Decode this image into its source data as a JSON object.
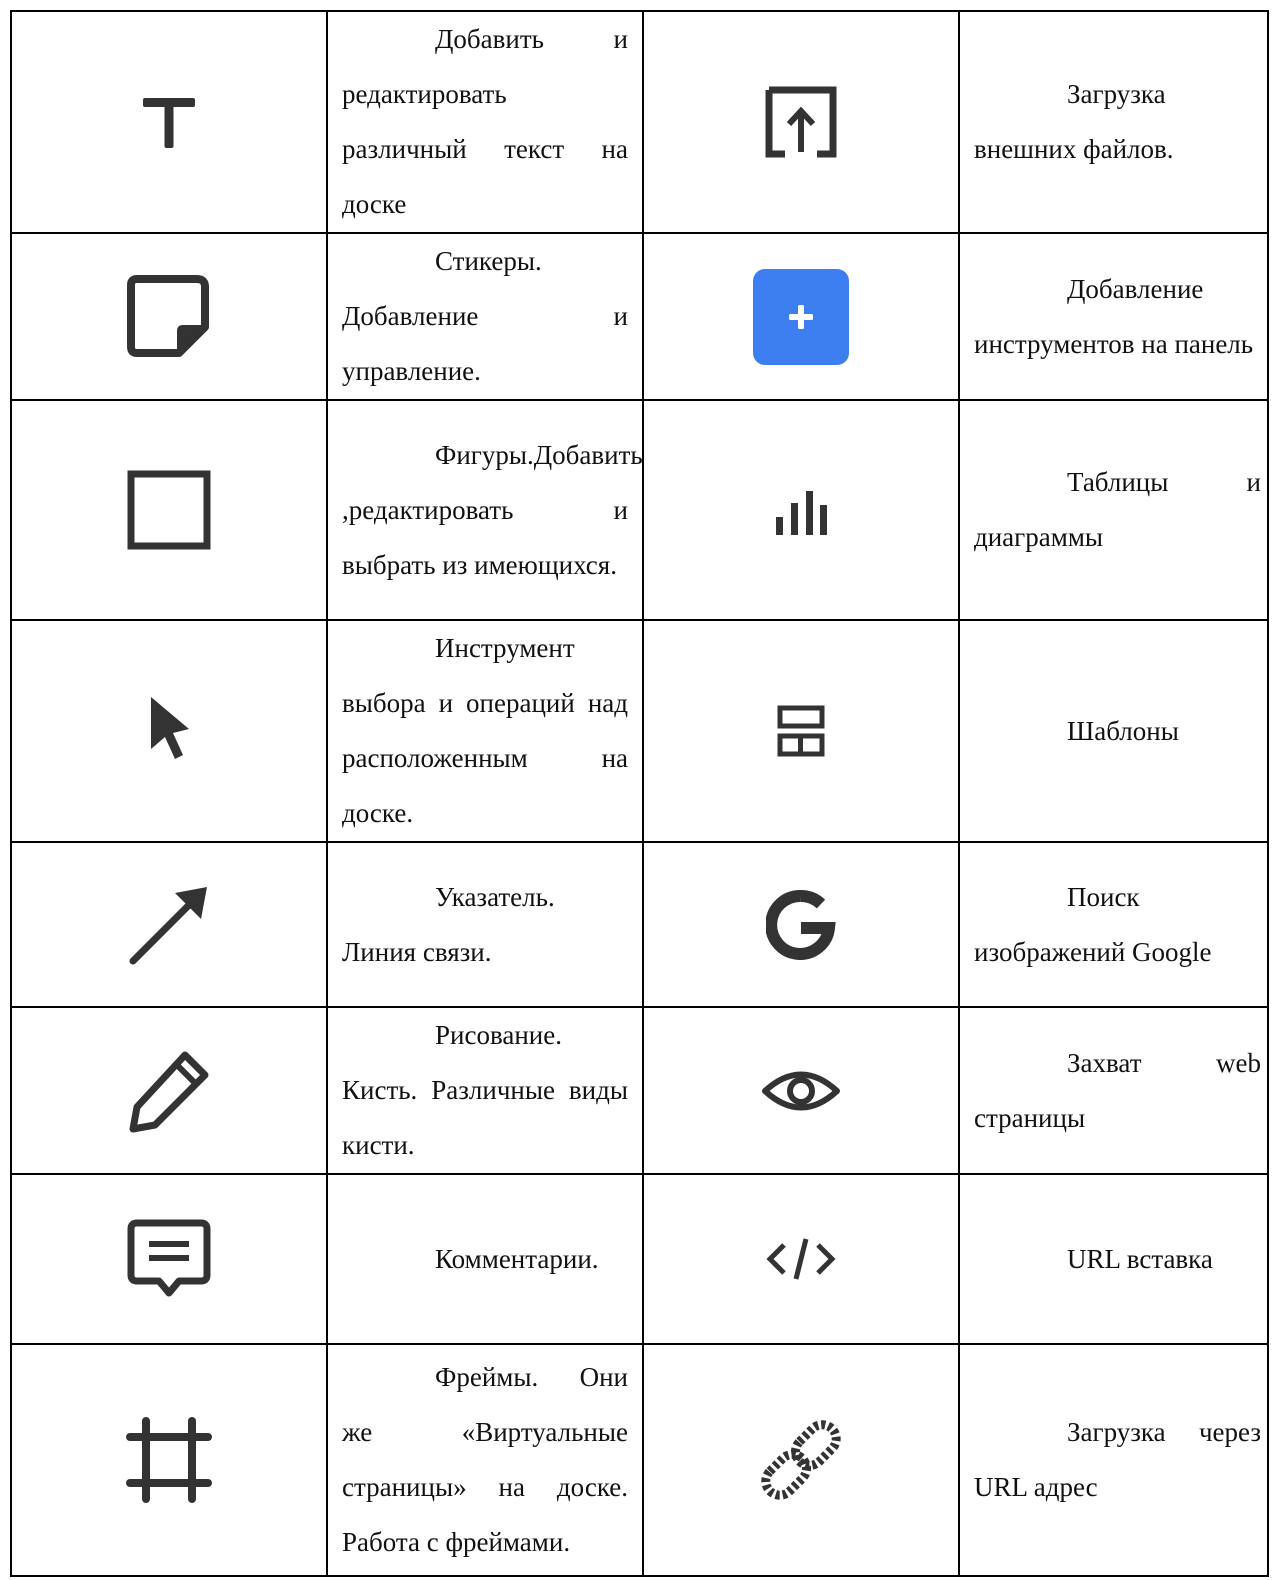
{
  "rows": [
    {
      "left_icon": "text-icon",
      "left_text": "Добавить и редактировать различный текст на доске",
      "right_icon": "upload-icon",
      "right_text": "Загрузка внешних файлов."
    },
    {
      "left_icon": "sticky-note-icon",
      "left_text": "Стикеры. Добавление и управление.",
      "right_icon": "add-plus-icon",
      "right_text": "Добавление инструментов на панель"
    },
    {
      "left_icon": "square-shape-icon",
      "left_text": "Фигуры.Добавить ,редактировать и выбрать из имеющихся.",
      "right_icon": "bar-chart-icon",
      "right_text": "Таблицы и диаграммы"
    },
    {
      "left_icon": "cursor-pointer-icon",
      "left_text": "Инструмент выбора и операций над расположенным на доске.",
      "right_icon": "templates-icon",
      "right_text": "Шаблоны"
    },
    {
      "left_icon": "arrow-line-icon",
      "left_text": "Указатель. Линия связи.",
      "right_icon": "google-icon",
      "right_text": "Поиск изображений Google"
    },
    {
      "left_icon": "pencil-icon",
      "left_text": "Рисование. Кисть. Различные виды кисти.",
      "right_icon": "eye-icon",
      "right_text": "Захват web страницы"
    },
    {
      "left_icon": "comment-icon",
      "left_text": "Комментарии.",
      "right_icon": "code-embed-icon",
      "right_text": "URL вставка"
    },
    {
      "left_icon": "frame-icon",
      "left_text": "Фреймы. Они же «Виртуальные страницы» на доске. Работа с фреймами.",
      "right_icon": "link-icon",
      "right_text": "Загрузка через URL адрес"
    }
  ],
  "colors": {
    "text": "#111111",
    "icon": "#333333",
    "accent_blue": "#3d7ff0",
    "border": "#000000"
  }
}
